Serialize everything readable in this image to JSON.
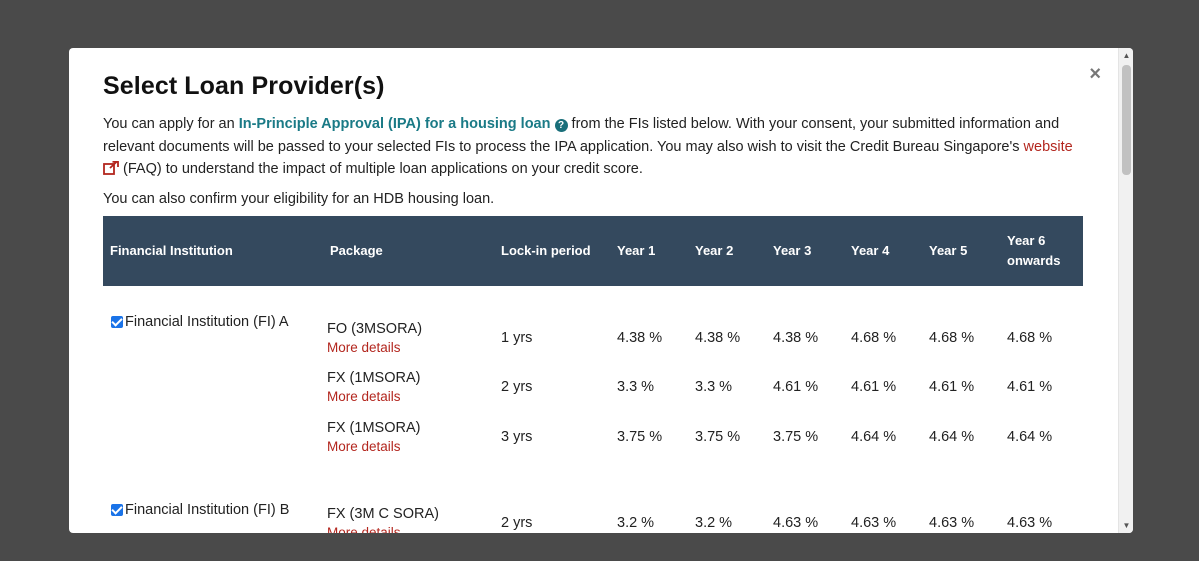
{
  "modal": {
    "title": "Select Loan Provider(s)",
    "close_label": "×",
    "intro": {
      "p1_before": "You can apply for an ",
      "ipa_link": "In-Principle Approval (IPA) for a housing loan",
      "help_icon": "?",
      "p1_after": " from the FIs listed below. With your consent, your submitted information and relevant documents will be passed to your selected FIs to process the IPA application. You may also wish to visit the Credit Bureau Singapore's ",
      "website_link": "website",
      "p1_end": " (FAQ) to understand the impact of multiple loan applications on your credit score.",
      "p2": "You can also confirm your eligibility for an HDB housing loan."
    },
    "table": {
      "headers": [
        "Financial Institution",
        "Package",
        "Lock-in period",
        "Year 1",
        "Year 2",
        "Year 3",
        "Year 4",
        "Year 5",
        "Year 6 onwards"
      ],
      "more_details_label": "More details",
      "institutions": [
        {
          "name": "Financial Institution (FI) A",
          "checked": true,
          "packages": [
            {
              "name": "FO (3MSORA)",
              "lock_in": "1 yrs",
              "rates": [
                "4.38 %",
                "4.38 %",
                "4.38 %",
                "4.68 %",
                "4.68 %",
                "4.68 %"
              ]
            },
            {
              "name": "FX (1MSORA)",
              "lock_in": "2 yrs",
              "rates": [
                "3.3 %",
                "3.3 %",
                "4.61 %",
                "4.61 %",
                "4.61 %",
                "4.61 %"
              ]
            },
            {
              "name": "FX (1MSORA)",
              "lock_in": "3 yrs",
              "rates": [
                "3.75 %",
                "3.75 %",
                "3.75 %",
                "4.64 %",
                "4.64 %",
                "4.64 %"
              ]
            }
          ]
        },
        {
          "name": "Financial Institution (FI) B",
          "checked": true,
          "packages": [
            {
              "name": "FX (3M C SORA)",
              "lock_in": "2 yrs",
              "rates": [
                "3.2 %",
                "3.2 %",
                "4.63 %",
                "4.63 %",
                "4.63 %",
                "4.63 %"
              ]
            }
          ]
        }
      ]
    }
  },
  "colors": {
    "header_bg": "#34495e",
    "link_teal": "#1a7a86",
    "link_red": "#b3261e",
    "overlay": "#4a4a4a"
  },
  "icons": {
    "close": "close-icon",
    "help": "help-circle-icon",
    "external": "external-link-icon",
    "checkbox": "checkbox-checked-icon"
  }
}
